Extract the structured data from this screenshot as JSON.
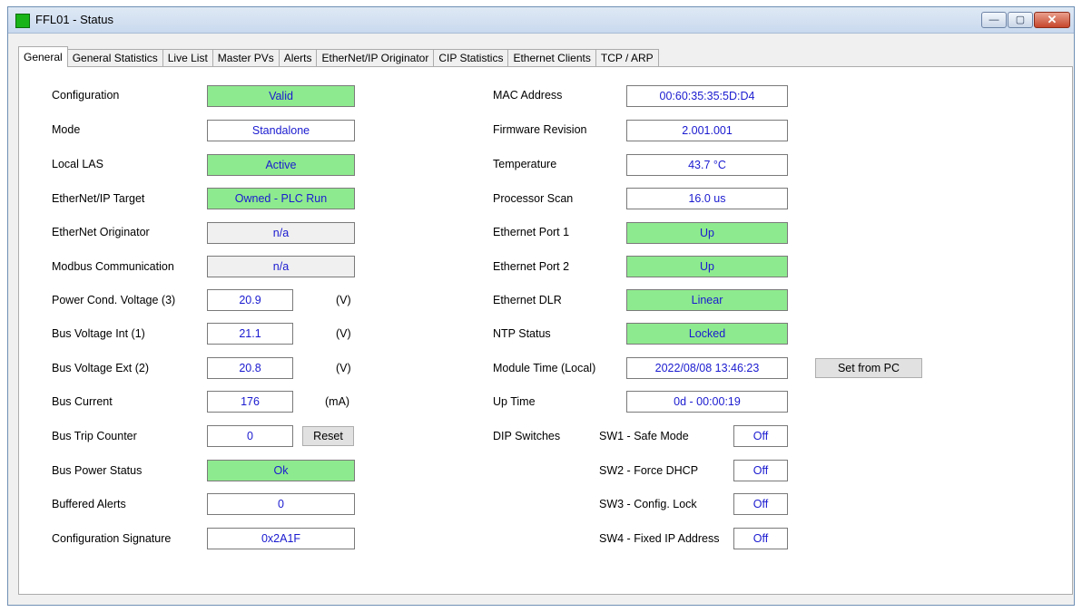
{
  "window": {
    "title": "FFL01 - Status",
    "icon": "green-square-icon",
    "controls": {
      "minimize": "—",
      "maximize": "▢",
      "close": "✕"
    }
  },
  "tabs": [
    "General",
    "General Statistics",
    "Live List",
    "Master PVs",
    "Alerts",
    "EtherNet/IP Originator",
    "CIP Statistics",
    "Ethernet Clients",
    "TCP / ARP"
  ],
  "active_tab": "General",
  "colors": {
    "green_field": "#8eea8e",
    "value_text": "#1a1ad0",
    "gray_field": "#f0f0f0"
  },
  "left": {
    "configuration": {
      "label": "Configuration",
      "value": "Valid"
    },
    "mode": {
      "label": "Mode",
      "value": "Standalone"
    },
    "local_las": {
      "label": "Local LAS",
      "value": "Active"
    },
    "enip_target": {
      "label": "EtherNet/IP Target",
      "value": "Owned - PLC Run"
    },
    "enet_originator": {
      "label": "EtherNet Originator",
      "value": "n/a"
    },
    "modbus": {
      "label": "Modbus Communication",
      "value": "n/a"
    },
    "power_cond_voltage": {
      "label": "Power Cond. Voltage (3)",
      "value": "20.9",
      "unit": "(V)"
    },
    "bus_voltage_int": {
      "label": "Bus Voltage Int (1)",
      "value": "21.1",
      "unit": "(V)"
    },
    "bus_voltage_ext": {
      "label": "Bus Voltage Ext (2)",
      "value": "20.8",
      "unit": "(V)"
    },
    "bus_current": {
      "label": "Bus Current",
      "value": "176",
      "unit": "(mA)"
    },
    "bus_trip_counter": {
      "label": "Bus Trip Counter",
      "value": "0",
      "button": "Reset"
    },
    "bus_power_status": {
      "label": "Bus Power Status",
      "value": "Ok"
    },
    "buffered_alerts": {
      "label": "Buffered Alerts",
      "value": "0"
    },
    "config_signature": {
      "label": "Configuration Signature",
      "value": "0x2A1F"
    }
  },
  "right": {
    "mac": {
      "label": "MAC Address",
      "value": "00:60:35:35:5D:D4"
    },
    "firmware": {
      "label": "Firmware Revision",
      "value": "2.001.001"
    },
    "temperature": {
      "label": "Temperature",
      "value": "43.7 °C"
    },
    "processor_scan": {
      "label": "Processor Scan",
      "value": "16.0 us"
    },
    "eth_port1": {
      "label": "Ethernet Port 1",
      "value": "Up"
    },
    "eth_port2": {
      "label": "Ethernet Port 2",
      "value": "Up"
    },
    "eth_dlr": {
      "label": "Ethernet DLR",
      "value": "Linear"
    },
    "ntp": {
      "label": "NTP Status",
      "value": "Locked"
    },
    "module_time": {
      "label": "Module Time (Local)",
      "value": "2022/08/08 13:46:23",
      "button": "Set from PC"
    },
    "up_time": {
      "label": "Up Time",
      "value": "0d - 00:00:19"
    },
    "dip": {
      "label": "DIP Switches",
      "sw1": {
        "label": "SW1 - Safe Mode",
        "value": "Off"
      },
      "sw2": {
        "label": "SW2 - Force DHCP",
        "value": "Off"
      },
      "sw3": {
        "label": "SW3 - Config. Lock",
        "value": "Off"
      },
      "sw4": {
        "label": "SW4 - Fixed IP Address",
        "value": "Off"
      }
    }
  }
}
